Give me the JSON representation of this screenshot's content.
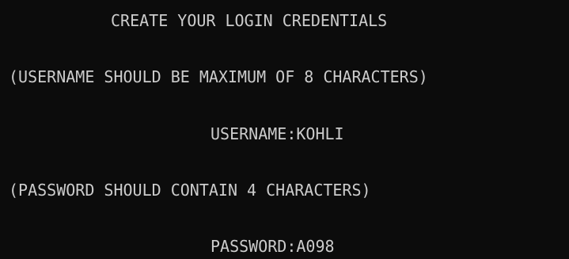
{
  "console": {
    "title_line": "CREATE YOUR LOGIN CREDENTIALS",
    "username_hint": "(USERNAME SHOULD BE MAXIMUM OF 8 CHARACTERS)",
    "username_line": "USERNAME:KOHLI",
    "password_hint": "(PASSWORD SHOULD CONTAIN 4 CHARACTERS)",
    "password_line": "PASSWORD:A098",
    "background_color": "#0c0c0c",
    "text_color": "#cccccc"
  }
}
